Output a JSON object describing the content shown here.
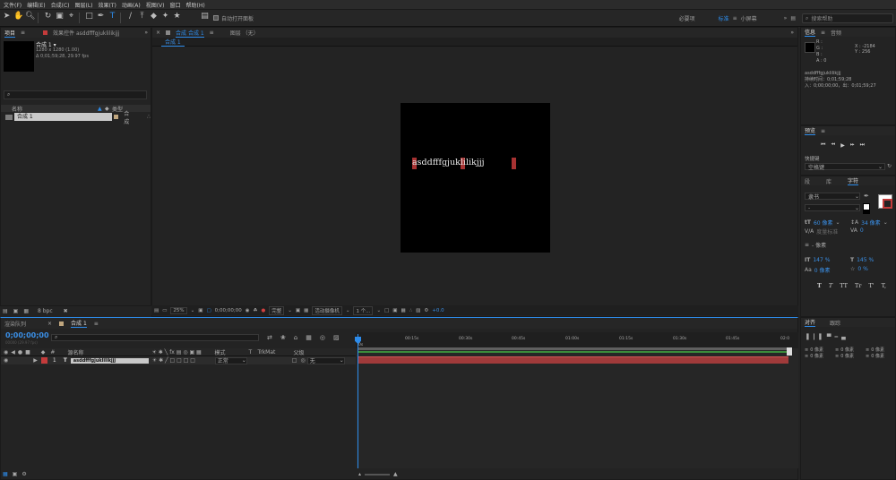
{
  "menu": [
    "文件(F)",
    "编辑(E)",
    "合成(C)",
    "图层(L)",
    "效果(T)",
    "动画(A)",
    "视图(V)",
    "窗口",
    "帮助(H)"
  ],
  "toolbar": {
    "auto_open_label": "自动打开面板",
    "workspaces": [
      "必要项",
      "标准",
      "小屏幕"
    ],
    "active_workspace": "标准",
    "search_placeholder": "搜索帮助"
  },
  "project": {
    "tab_project": "项目",
    "tab_effects": "效果控件 asddfffgjuklilikjjj",
    "comp_name": "合成 1 ▾",
    "comp_size": "1280 x 1280 (1.00)",
    "comp_duration": "Δ 0;01;59;28, 29.97 fps",
    "search_placeholder": "",
    "col_name": "名称",
    "col_type": "类型",
    "item_name": "合成 1",
    "item_type": "合成",
    "bpc": "8 bpc"
  },
  "viewer": {
    "tab_comp": "合成 合成 1",
    "tab_layer": "图层 （无）",
    "flow_tab": "合成 1",
    "canvas_text": "asddfffgjuklilikjjj",
    "zoom": "25%",
    "timecode": "0;00;00;00",
    "resolution": "完整",
    "camera": "活动摄像机",
    "views": "1 个...",
    "exposure": "+0.0"
  },
  "info": {
    "tab_info": "信息",
    "tab_audio": "音频",
    "r": "R :",
    "g": "G :",
    "b": "B :",
    "a": "A : 0",
    "x": "X : -2184",
    "y": "Y : 256",
    "layer_name": "asddfffgjuklilikjjj",
    "duration": "持续时间：0;01;59;28",
    "in_out": "入：0;00;00;00，出：0;01;59;27"
  },
  "preview": {
    "tab": "预览",
    "shortcut_label": "快捷键",
    "shortcut_value": "空格键"
  },
  "character": {
    "tabs": [
      "段",
      "库",
      "字符"
    ],
    "active_tab": "字符",
    "font": "隶书",
    "style": "-",
    "size": "60 像素",
    "leading": "34 像素",
    "kerning": "度量标准",
    "tracking": "0",
    "stroke": "- 像素",
    "vscale": "147 %",
    "hscale": "145 %",
    "baseline": "0 像素",
    "tsume": "0 %",
    "styles": [
      "T",
      "T",
      "TT",
      "Tr",
      "T'",
      "T,"
    ]
  },
  "align": {
    "tab_align": "对齐",
    "tab_other": "跟踪",
    "values": [
      "0 像素",
      "0 像素",
      "0 像素",
      "0 像素",
      "0 像素",
      "0 像素",
      "0 像素",
      "0 像素"
    ]
  },
  "timeline": {
    "tab_render": "渲染队列",
    "tab_comp": "合成 1",
    "timecode": "0;00;00;00",
    "timecode_sub": "00000 (29.97 fps)",
    "search_placeholder": "",
    "col_source": "源名称",
    "col_mode": "模式",
    "col_t": "T",
    "col_trkmat": "TrkMat",
    "col_parent": "父级",
    "layer_num": "1",
    "layer_name": "asddfffgjuklilikjjj",
    "layer_mode": "正常",
    "layer_parent": "无",
    "ticks": [
      "0s",
      "00:15s",
      "00:30s",
      "00:45s",
      "01:00s",
      "01:15s",
      "01:30s",
      "01:45s",
      "02:0"
    ]
  },
  "colors": {
    "accent": "#2d8ceb",
    "layer_label": "#c43b3b",
    "layer_bar": "#a03a3a"
  }
}
